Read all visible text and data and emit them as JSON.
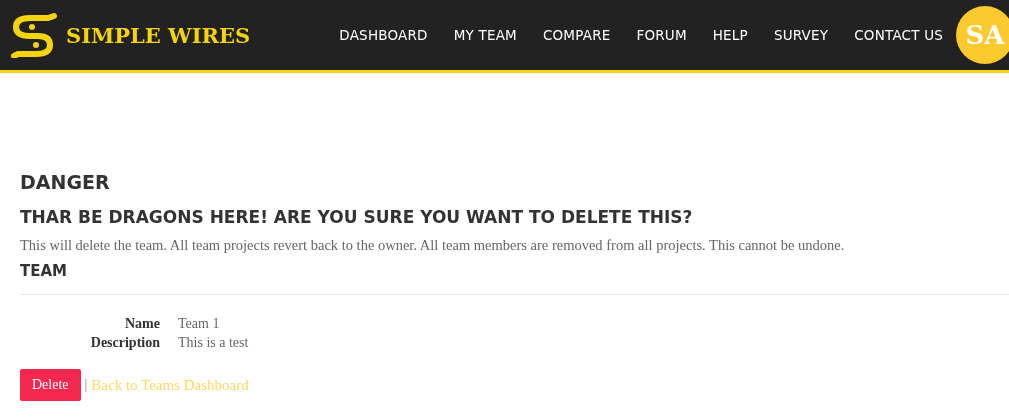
{
  "brand": {
    "name": "SIMPLE WIRES"
  },
  "nav": [
    {
      "label": "DASHBOARD"
    },
    {
      "label": "MY TEAM"
    },
    {
      "label": "COMPARE"
    },
    {
      "label": "FORUM"
    },
    {
      "label": "HELP"
    },
    {
      "label": "SURVEY"
    },
    {
      "label": "CONTACT US"
    }
  ],
  "avatar": {
    "initials": "SA"
  },
  "title": "DANGER",
  "subtitle": "THAR BE DRAGONS HERE! ARE YOU SURE YOU WANT TO DELETE THIS?",
  "warning": "This will delete the team. All team projects revert back to the owner. All team members are removed from all projects. This cannot be undone.",
  "section": "TEAM",
  "details": [
    {
      "label": "Name",
      "value": "Team 1"
    },
    {
      "label": "Description",
      "value": "This is a test"
    }
  ],
  "actions": {
    "delete": "Delete",
    "separator": "|",
    "back_link": "Back to Teams Dashboard"
  }
}
